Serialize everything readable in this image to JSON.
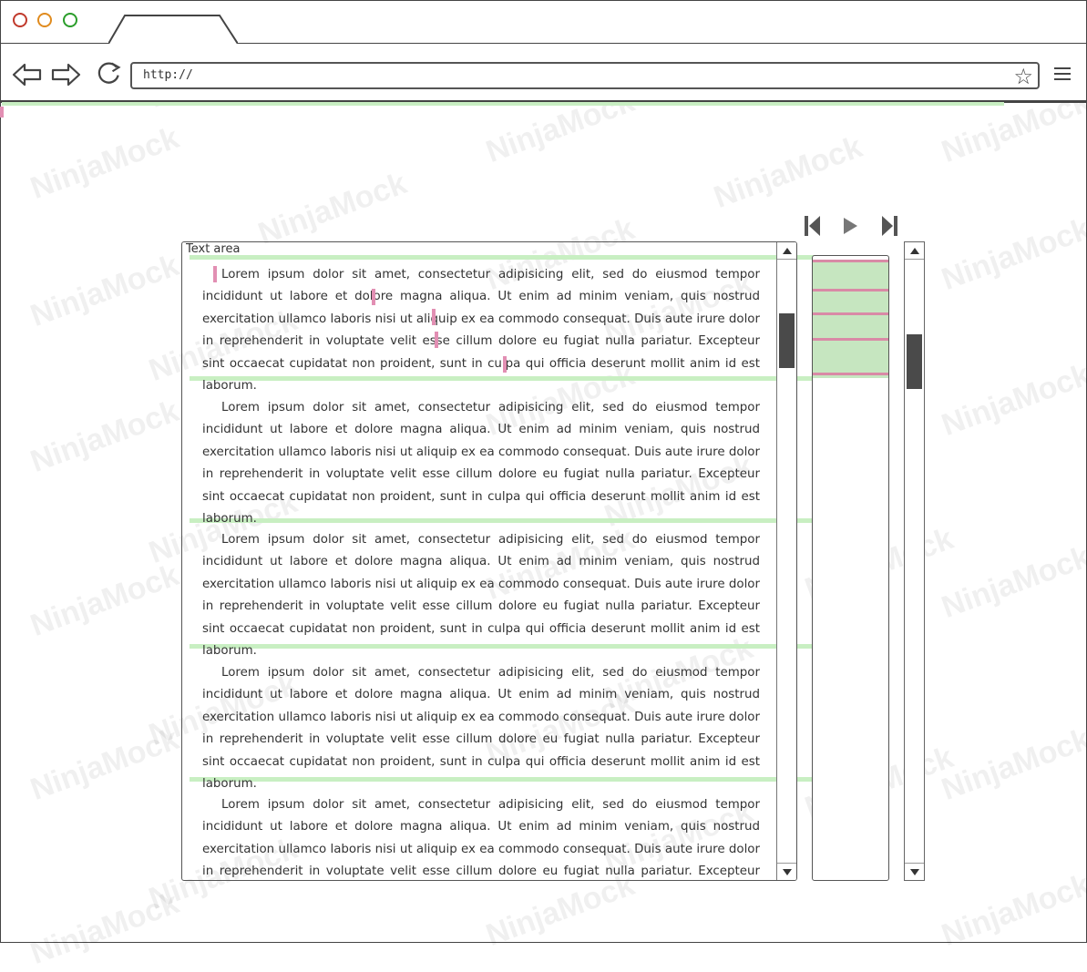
{
  "browser": {
    "url": "http://",
    "watermark": "NinjaMock"
  },
  "textarea": {
    "label": "Text area",
    "paragraph": "Lorem ipsum dolor sit amet, consectetur adipisicing elit, sed do eiusmod tempor incididunt ut labore et dolore magna aliqua. Ut enim ad minim veniam, quis nostrud exercitation ullamco laboris nisi ut aliquip ex ea commodo consequat. Duis aute irure dolor in reprehenderit in voluptate velit esse cillum dolore eu fugiat nulla pariatur. Excepteur sint occaecat cupidatat non proident, sunt in culpa qui officia deserunt mollit anim id est laborum.",
    "paragraph_count": 5
  },
  "colors": {
    "highlight": "#c8efc2",
    "marker": "#e28fb3",
    "minimap_view": "#c6e6c0",
    "scroll_thumb": "#4a4a4a"
  },
  "icons": [
    "back-arrow-icon",
    "forward-arrow-icon",
    "reload-icon",
    "star-icon",
    "menu-icon",
    "skip-previous-icon",
    "play-icon",
    "skip-next-icon"
  ]
}
